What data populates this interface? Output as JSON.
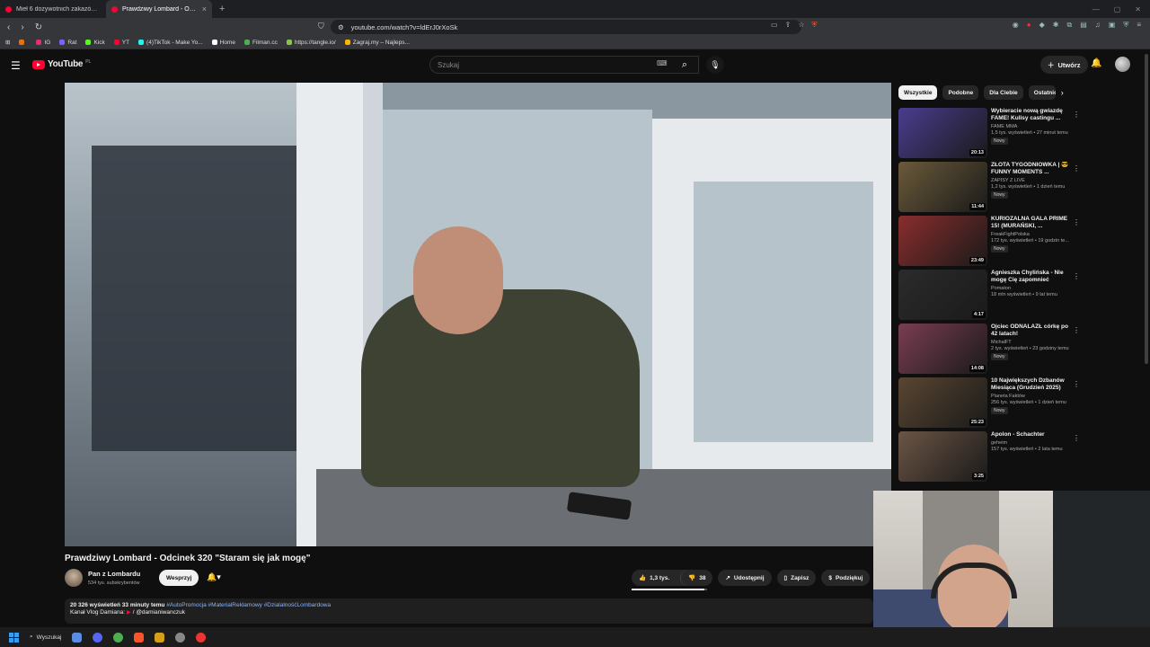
{
  "browser": {
    "tabs": [
      {
        "title": "Mieł 6 dożywotnich zakazów i jeź",
        "active": false
      },
      {
        "title": "Prawdziwy Lombard - Odcin",
        "active": true
      }
    ],
    "new_tab": "+",
    "url": "youtube.com/watch?v=ldErJ0rXoSk",
    "bookmarks": [
      {
        "label": "",
        "color": "#e8710a"
      },
      {
        "label": "IG",
        "color": "#e1306c"
      },
      {
        "label": "Rat",
        "color": "#7b61ff"
      },
      {
        "label": "Kick",
        "color": "#53fc18"
      },
      {
        "label": "YT",
        "color": "#ff0033"
      },
      {
        "label": "(4)TikTok - Make Yo...",
        "color": "#25f4ee"
      },
      {
        "label": "Home",
        "color": "#ffffff"
      },
      {
        "label": "Filman.cc",
        "color": "#4caf50"
      },
      {
        "label": "https://tangle.io/",
        "color": "#8bc34a"
      },
      {
        "label": "Zagraj.my – Najleps...",
        "color": "#ffb300"
      }
    ]
  },
  "youtube": {
    "logo_text": "YouTube",
    "region": "PL",
    "search_placeholder": "Szukaj",
    "create_label": "Utwórz"
  },
  "video": {
    "title": "Prawdziwy Lombard - Odcinek 320 \"Staram się jak mogę\"",
    "channel": "Pan z Lombardu",
    "subscribers": "534 tys. subskrybentów",
    "support_label": "Wesprzyj",
    "likes": "1,3 tys.",
    "dislikes": "38",
    "like_ratio": 0.97,
    "share_label": "Udostępnij",
    "save_label": "Zapisz",
    "thanks_label": "Podziękuj",
    "stats": "20 326 wyświetleń  33 minuty temu",
    "tags": "#AutoPromocja #MaterialReklamowy #DzialalnośćLombardowa",
    "desc_line2": "Kanał Vlog Damiana:",
    "desc_link": "/ @damianiwanczuk"
  },
  "chips": [
    "Wszystkie",
    "Podobne",
    "Dla Ciebie",
    "Ostatnio"
  ],
  "recommendations": [
    {
      "title": "Wybieracie nową gwiazdę FAME! Kulisy castingu ...",
      "channel": "FAME MMA",
      "meta": "1,5 tys. wyświetleń • 27 minut temu",
      "badge": "Nowy",
      "duration": "20:13",
      "color": "#4a3d8f"
    },
    {
      "title": "ZŁOTA TYGODNIÓWKA | 😎 FUNNY MOMENTS ...",
      "channel": "ZAPISY Z LIVE",
      "meta": "1,2 tys. wyświetleń • 1 dzień temu",
      "badge": "Nowy",
      "duration": "11:44",
      "color": "#6b5a3a"
    },
    {
      "title": "KURIOZALNA GALA PRIME 15! (MURAŃSKI, ...",
      "channel": "FreakFightPolska",
      "meta": "172 tys. wyświetleń • 19 godzin te...",
      "badge": "Nowy",
      "duration": "23:49",
      "color": "#8a2d2d"
    },
    {
      "title": "Agnieszka Chylińska - Nie mogę Cię zapomnieć",
      "channel": "Pomaton",
      "meta": "18 mln wyświetleń • 9 lat temu",
      "badge": "",
      "duration": "4:17",
      "color": "#2b2b2b"
    },
    {
      "title": "Ojciec ODNALAZŁ córkę po 42 latach!",
      "channel": "MichalFT",
      "meta": "2 tys. wyświetleń • 23 godziny temu",
      "badge": "Nowy",
      "duration": "14:08",
      "color": "#7a3d52"
    },
    {
      "title": "10 Największych Dzbanów Miesiąca (Grudzień 2025)",
      "channel": "Planeta Faktów",
      "meta": "256 tys. wyświetleń • 1 dzień temu",
      "badge": "Nowy",
      "duration": "25:23",
      "color": "#5a4632"
    },
    {
      "title": "Apolon - Schachter",
      "channel": "geheim",
      "meta": "157 tys. wyświetleń • 2 lata temu",
      "badge": "",
      "duration": "3:25",
      "color": "#6b5545"
    }
  ],
  "taskbar": {
    "search_label": "Wyszukaj"
  }
}
